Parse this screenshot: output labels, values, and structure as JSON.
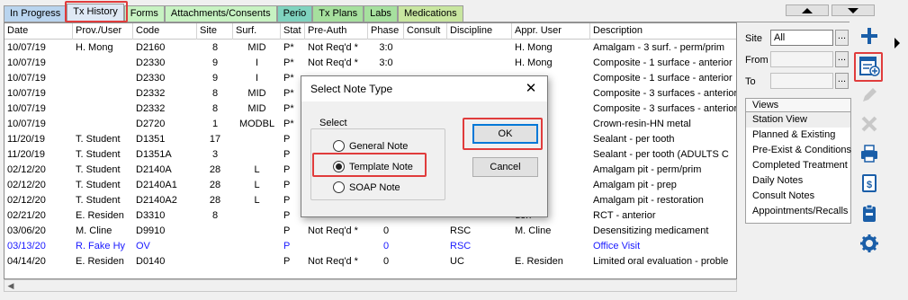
{
  "tabs": [
    {
      "label": "In Progress",
      "color": "#b9d4ee"
    },
    {
      "label": "Tx History",
      "color": "#dfe9f5"
    },
    {
      "label": "Forms",
      "color": "#c7f2c2"
    },
    {
      "label": "Attachments/Consents",
      "color": "#c7f2c2"
    },
    {
      "label": "Perio",
      "color": "#7fd3bf"
    },
    {
      "label": "Tx Plans",
      "color": "#a6e09e"
    },
    {
      "label": "Labs",
      "color": "#a6e09e"
    },
    {
      "label": "Medications",
      "color": "#c8e6a0"
    }
  ],
  "table": {
    "columns": [
      "Date",
      "Prov./User",
      "Code",
      "Site",
      "Surf.",
      "Stat",
      "Pre-Auth",
      "Phase",
      "Consult",
      "Discipline",
      "Appr. User",
      "Description"
    ],
    "rows": [
      {
        "date": "10/07/19",
        "prov": "H. Mong",
        "code": "D2160",
        "site": "8",
        "surf": "MID",
        "stat": "P*",
        "preauth": "Not Req'd *",
        "phase": "3:0",
        "consult": "",
        "discipline": "",
        "appr": "H. Mong",
        "desc": "Amalgam - 3 surf. - perm/prim",
        "blue": false
      },
      {
        "date": "10/07/19",
        "prov": "",
        "code": "D2330",
        "site": "9",
        "surf": "I",
        "stat": "P*",
        "preauth": "Not Req'd *",
        "phase": "3:0",
        "consult": "",
        "discipline": "",
        "appr": "H. Mong",
        "desc": "Composite - 1 surface - anterior",
        "blue": false
      },
      {
        "date": "10/07/19",
        "prov": "",
        "code": "D2330",
        "site": "9",
        "surf": "I",
        "stat": "P*",
        "preauth": "",
        "phase": "",
        "consult": "",
        "discipline": "",
        "appr": "",
        "desc": "Composite - 1 surface - anterior",
        "blue": false
      },
      {
        "date": "10/07/19",
        "prov": "",
        "code": "D2332",
        "site": "8",
        "surf": "MID",
        "stat": "P*",
        "preauth": "",
        "phase": "",
        "consult": "",
        "discipline": "",
        "appr": "",
        "desc": "Composite - 3 surfaces - anterior",
        "blue": false
      },
      {
        "date": "10/07/19",
        "prov": "",
        "code": "D2332",
        "site": "8",
        "surf": "MID",
        "stat": "P*",
        "preauth": "",
        "phase": "",
        "consult": "",
        "discipline": "",
        "appr": "",
        "desc": "Composite - 3 surfaces - anterior",
        "blue": false
      },
      {
        "date": "10/07/19",
        "prov": "",
        "code": "D2720",
        "site": "1",
        "surf": "MODBL",
        "stat": "P*",
        "preauth": "",
        "phase": "",
        "consult": "",
        "discipline": "",
        "appr": "",
        "desc": "Crown-resin-HN metal",
        "blue": false
      },
      {
        "date": "11/20/19",
        "prov": "T. Student",
        "code": "D1351",
        "site": "17",
        "surf": "",
        "stat": "P",
        "preauth": "",
        "phase": "",
        "consult": "",
        "discipline": "",
        "appr": "ulty",
        "desc": "Sealant - per tooth",
        "blue": false
      },
      {
        "date": "11/20/19",
        "prov": "T. Student",
        "code": "D1351A",
        "site": "3",
        "surf": "",
        "stat": "P",
        "preauth": "",
        "phase": "",
        "consult": "",
        "discipline": "",
        "appr": "ulty",
        "desc": "Sealant - per tooth (ADULTS C",
        "blue": false
      },
      {
        "date": "02/12/20",
        "prov": "T. Student",
        "code": "D2140A",
        "site": "28",
        "surf": "L",
        "stat": "P",
        "preauth": "",
        "phase": "",
        "consult": "",
        "discipline": "",
        "appr": "amo",
        "desc": "Amalgam pit - perm/prim",
        "blue": false
      },
      {
        "date": "02/12/20",
        "prov": "T. Student",
        "code": "D2140A1",
        "site": "28",
        "surf": "L",
        "stat": "P",
        "preauth": "",
        "phase": "",
        "consult": "",
        "discipline": "",
        "appr": "amo",
        "desc": "Amalgam pit - prep",
        "blue": false
      },
      {
        "date": "02/12/20",
        "prov": "T. Student",
        "code": "D2140A2",
        "site": "28",
        "surf": "L",
        "stat": "P",
        "preauth": "",
        "phase": "",
        "consult": "",
        "discipline": "",
        "appr": "amo",
        "desc": "Amalgam pit - restoration",
        "blue": false
      },
      {
        "date": "02/21/20",
        "prov": "E. Residen",
        "code": "D3310",
        "site": "8",
        "surf": "",
        "stat": "P",
        "preauth": "",
        "phase": "",
        "consult": "",
        "discipline": "",
        "appr": "den",
        "desc": "RCT - anterior",
        "blue": false
      },
      {
        "date": "03/06/20",
        "prov": "M. Cline",
        "code": "D9910",
        "site": "",
        "surf": "",
        "stat": "P",
        "preauth": "Not Req'd *",
        "phase": "0",
        "consult": "",
        "discipline": "RSC",
        "appr": "M. Cline",
        "desc": "Desensitizing medicament",
        "blue": false
      },
      {
        "date": "03/13/20",
        "prov": "R. Fake Hy",
        "code": "OV",
        "site": "",
        "surf": "",
        "stat": "P",
        "preauth": "",
        "phase": "0",
        "consult": "",
        "discipline": "RSC",
        "appr": "",
        "desc": "Office Visit",
        "blue": true
      },
      {
        "date": "04/14/20",
        "prov": "E. Residen",
        "code": "D0140",
        "site": "",
        "surf": "",
        "stat": "P",
        "preauth": "Not Req'd *",
        "phase": "0",
        "consult": "",
        "discipline": "UC",
        "appr": "E. Residen",
        "desc": "Limited oral evaluation - proble",
        "blue": false
      }
    ]
  },
  "filter": {
    "site_label": "Site",
    "site_value": "All",
    "from_label": "From",
    "from_value": "",
    "to_label": "To",
    "to_value": "",
    "browse": "...",
    "views_header": "Views",
    "views": [
      "Station View",
      "Planned & Existing",
      "Pre-Exist & Conditions",
      "Completed Treatment",
      "Daily Notes",
      "Consult Notes",
      "Appointments/Recalls"
    ]
  },
  "toolbar": [
    "add-icon",
    "new-note-icon",
    "edit-icon",
    "delete-icon",
    "print-icon",
    "billing-icon",
    "clipboard-icon",
    "settings-icon"
  ],
  "dialog": {
    "title": "Select Note Type",
    "close": "✕",
    "group_label": "Select",
    "options": [
      "General Note",
      "Template Note",
      "SOAP Note"
    ],
    "selected": "Template Note",
    "ok": "OK",
    "cancel": "Cancel"
  },
  "colors": {
    "accent_blue": "#1a5ea8",
    "highlight_red": "#e03c3c"
  }
}
